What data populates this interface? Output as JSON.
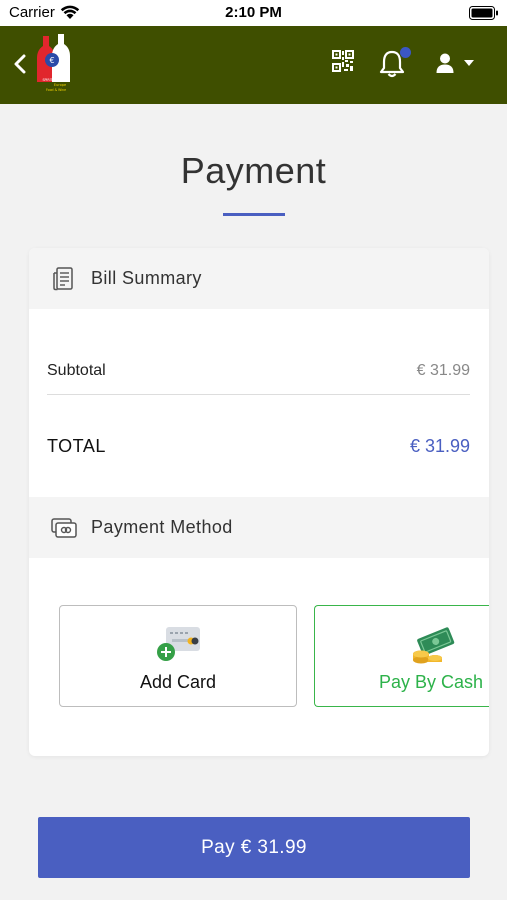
{
  "status_bar": {
    "carrier": "Carrier",
    "time": "2:10 PM"
  },
  "app_bar": {
    "background": "#3f4f00",
    "notification_badge_color": "#3b57c4",
    "logo_text": [
      "SPIRITS & WINES",
      "Europe",
      "Food & Wine"
    ]
  },
  "page": {
    "title": "Payment"
  },
  "bill_summary": {
    "heading": "Bill Summary",
    "subtotal_label": "Subtotal",
    "subtotal_value": "€ 31.99",
    "total_label": "TOTAL",
    "total_value": "€ 31.99"
  },
  "payment_method": {
    "heading": "Payment Method",
    "options": [
      {
        "label": "Add Card",
        "icon": "add-card-icon",
        "selected": false
      },
      {
        "label": "Pay By Cash",
        "icon": "cash-icon",
        "selected": true
      }
    ]
  },
  "pay_button": {
    "label": "Pay € 31.99"
  },
  "colors": {
    "accent": "#4a5fc1",
    "selected": "#2db24a"
  }
}
